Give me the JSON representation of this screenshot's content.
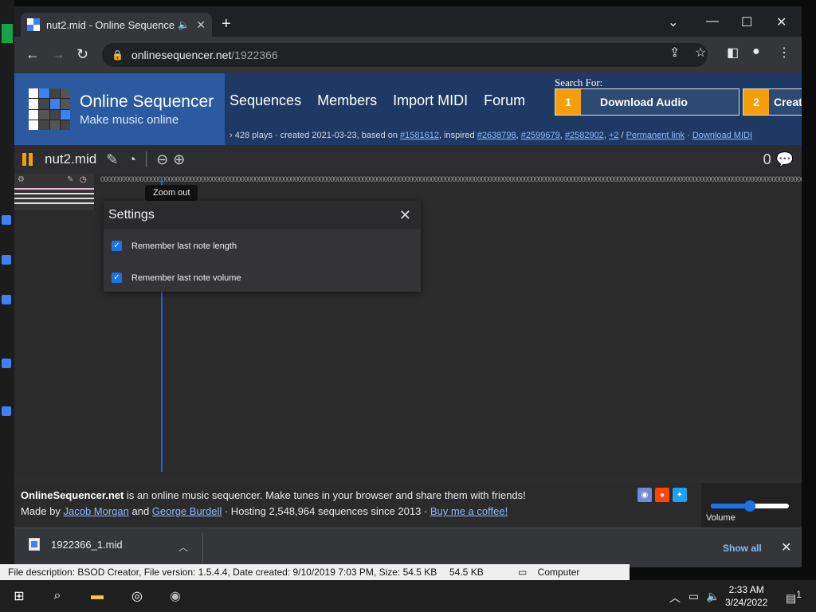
{
  "browser": {
    "tab_title": "nut2.mid - Online Sequencer",
    "url_host": "onlinesequencer.net",
    "url_path": "/1922366"
  },
  "site": {
    "logo_title": "Online Sequencer",
    "logo_subtitle": "Make music online",
    "nav": [
      "Sequences",
      "Members",
      "Import MIDI",
      "Forum"
    ],
    "search_for": "Search For:",
    "ad_buttons": [
      {
        "num": "1",
        "label": "Download Audio"
      },
      {
        "num": "2",
        "label": "Creat"
      }
    ],
    "info": {
      "prefix": "428 plays · created 2021-03-23, based on ",
      "based_on": "#1581612",
      "inspired_label": ", inspired ",
      "inspired": [
        "#2638798",
        "#2599679",
        "#2582902",
        "+2"
      ],
      "sep": " / ",
      "permanent": "Permanent link",
      "dot": " · ",
      "download_midi": "Download MIDI"
    }
  },
  "sequence": {
    "title": "nut2.mid",
    "comment_count": "0",
    "timeline_text": "0000000000000000000000000000000000000000000000000000000000000000000000000000000000000000000000000000000000000000000000000000000000000000000000000000000000000000000000000000000000000000000000000000",
    "tooltip": "Zoom out"
  },
  "settings": {
    "title": "Settings",
    "options": [
      {
        "label": "Remember last note length",
        "checked": true
      },
      {
        "label": "Remember last note volume",
        "checked": true
      }
    ]
  },
  "footer": {
    "brand": "OnlineSequencer.net",
    "line1_rest": " is an online music sequencer. Make tunes in your browser and share them with friends!",
    "made_by": "Made by ",
    "author1": "Jacob Morgan",
    "and": " and ",
    "author2": "George Burdell",
    "hosting": " · Hosting 2,548,964 sequences since 2013 · ",
    "coffee": "Buy me a coffee!",
    "volume_label": "Volume",
    "volume_level": 0.5
  },
  "downloads": {
    "filename": "1922366_1.mid",
    "show_all": "Show all"
  },
  "explorer_status": {
    "description": "File description: BSOD Creator, File version: 1.5.4.4, Date created: 9/10/2019 7:03 PM, Size: 54.5 KB",
    "size": "54.5 KB",
    "location": "Computer"
  },
  "taskbar": {
    "time": "2:33 AM",
    "date": "3/24/2022",
    "notification_count": "1"
  },
  "colors": {
    "accent_orange": "#f59e0b",
    "header_blue": "#1e3a64",
    "link_blue": "#8fb8ff",
    "checkbox_blue": "#1a73e8"
  }
}
